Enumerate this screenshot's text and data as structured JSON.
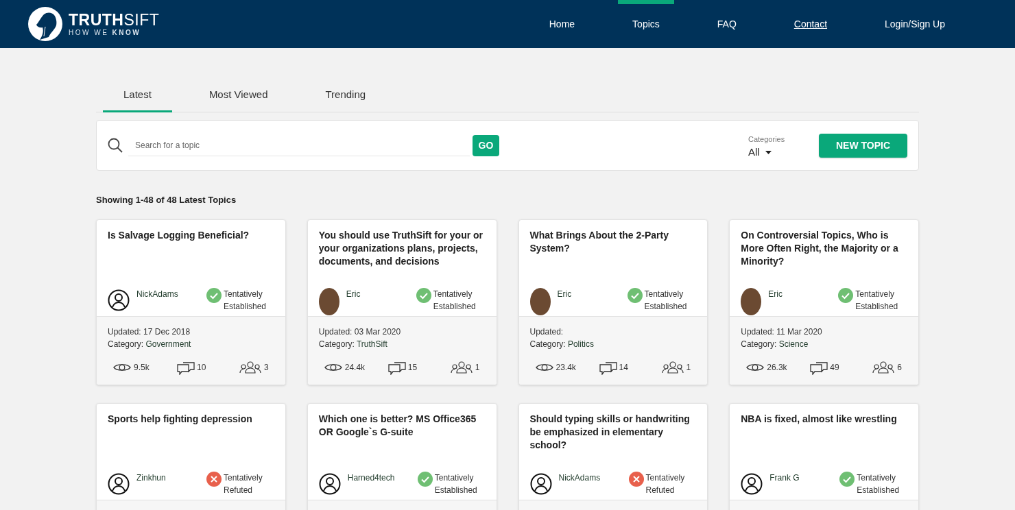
{
  "header": {
    "logo": {
      "name": "**TRUTH**SIFT",
      "tagline": "HOW WE **KNOW**"
    },
    "nav": [
      {
        "label": "Home",
        "selected": false,
        "underlined": false
      },
      {
        "label": "Topics",
        "selected": true,
        "underlined": false
      },
      {
        "label": "FAQ",
        "selected": false,
        "underlined": false
      },
      {
        "label": "Contact",
        "selected": false,
        "underlined": true
      },
      {
        "label": "Login/Sign Up",
        "selected": false,
        "underlined": false
      }
    ]
  },
  "tabs": [
    {
      "label": "Latest",
      "selected": true
    },
    {
      "label": "Most Viewed",
      "selected": false
    },
    {
      "label": "Trending",
      "selected": false
    }
  ],
  "search": {
    "placeholder": "Search for a topic",
    "go_button": "GO",
    "categories_label": "Categories",
    "categories_value": "All",
    "new_topic_button": "NEW TOPIC"
  },
  "summary": "Showing 1-48 of 48 Latest Topics",
  "topics": [
    {
      "title": "Is Salvage Logging Beneficial?",
      "author": "NickAdams",
      "avatar": {
        "kind": "default"
      },
      "status": {
        "kind": "established",
        "line1": "Tentatively",
        "line2": "Established"
      },
      "updated": "Updated: 17 Dec 2018",
      "category_label": "Category:",
      "category": "Government",
      "views": "9.5k",
      "comments": "10",
      "participants": "3"
    },
    {
      "title": "You should use TruthSift for your or your organizations plans, projects, documents, and decisions",
      "author": "Eric",
      "avatar": {
        "kind": "photo"
      },
      "status": {
        "kind": "established",
        "line1": "Tentatively",
        "line2": "Established"
      },
      "updated": "Updated: 03 Mar 2020",
      "category_label": "Category:",
      "category": "TruthSift",
      "views": "24.4k",
      "comments": "15",
      "participants": "1"
    },
    {
      "title": "What Brings About the 2-Party System?",
      "author": "Eric",
      "avatar": {
        "kind": "photo"
      },
      "status": {
        "kind": "established",
        "line1": "Tentatively",
        "line2": "Established"
      },
      "updated": "Updated:",
      "category_label": "Category:",
      "category": "Politics",
      "views": "23.4k",
      "comments": "14",
      "participants": "1"
    },
    {
      "title": "On Controversial Topics, Who is More Often Right, the Majority or a Minority?",
      "author": "Eric",
      "avatar": {
        "kind": "photo"
      },
      "status": {
        "kind": "established",
        "line1": "Tentatively",
        "line2": "Established"
      },
      "updated": "Updated: 11 Mar 2020",
      "category_label": "Category:",
      "category": "Science",
      "views": "26.3k",
      "comments": "49",
      "participants": "6"
    },
    {
      "title": "Sports help fighting depression",
      "author": "Zinkhun",
      "avatar": {
        "kind": "default"
      },
      "status": {
        "kind": "refuted",
        "line1": "Tentatively",
        "line2": "Refuted"
      }
    },
    {
      "title": "Which one is better? MS Office365 OR Google`s G-suite",
      "author": "Harned4tech",
      "avatar": {
        "kind": "default"
      },
      "status": {
        "kind": "established",
        "line1": "Tentatively",
        "line2": "Established"
      }
    },
    {
      "title": "Should typing skills or handwriting be emphasized in elementary school?",
      "author": "NickAdams",
      "avatar": {
        "kind": "default"
      },
      "status": {
        "kind": "refuted",
        "line1": "Tentatively",
        "line2": "Refuted"
      }
    },
    {
      "title": "NBA is fixed, almost like wrestling",
      "author": "Frank G",
      "avatar": {
        "kind": "default"
      },
      "status": {
        "kind": "established",
        "line1": "Tentatively",
        "line2": "Established"
      }
    }
  ]
}
